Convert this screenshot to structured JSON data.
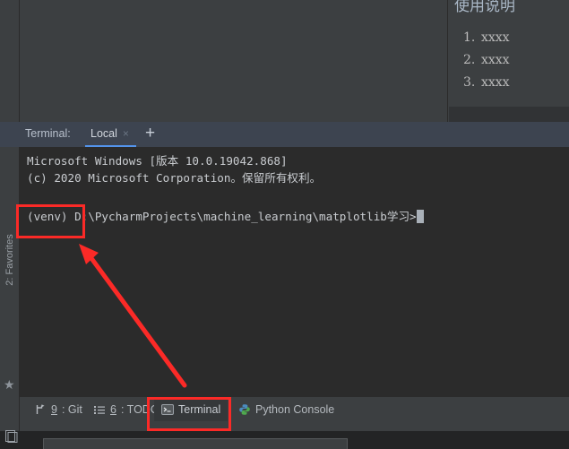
{
  "theme": {
    "editor_bg": "#3c3f41",
    "terminal_bg": "#2b2b2b",
    "tabbar_bg": "#3d4450",
    "accent_tab_underline": "#5394ec",
    "terminal_text": "#c9ccd0",
    "annotation_red": "#fb2a27"
  },
  "usage_panel": {
    "title": "使用说明",
    "items": [
      {
        "num": "1.",
        "text": "xxxx"
      },
      {
        "num": "2.",
        "text": "xxxx"
      },
      {
        "num": "3.",
        "text": "xxxx"
      }
    ]
  },
  "terminal_tabbar": {
    "label": "Terminal:",
    "active_tab": "Local",
    "close_glyph": "×",
    "add_glyph": "+"
  },
  "terminal": {
    "line1": "Microsoft Windows [版本 10.0.19042.868]",
    "line2": "(c) 2020 Microsoft Corporation。保留所有权利。",
    "prompt_venv": "(venv) ",
    "prompt_path": "D:\\PycharmProjects\\machine_learning\\matplotlib学习>"
  },
  "left_rail": {
    "favorites_label": "2: Favorites",
    "star_glyph": "★"
  },
  "statusbar": {
    "items": [
      {
        "key": "9",
        "label": ": Git",
        "icon": "git-branch-icon"
      },
      {
        "key": "6",
        "label": ": TODO",
        "icon": "list-icon"
      },
      {
        "key": "",
        "label": "Terminal",
        "icon": "terminal-icon"
      },
      {
        "key": "",
        "label": "Python Console",
        "icon": "python-icon"
      }
    ]
  },
  "annotations": {
    "box_venv": "highlight-venv",
    "box_terminal": "highlight-terminal-button",
    "arrow": "arrow-pointing-to-venv"
  }
}
